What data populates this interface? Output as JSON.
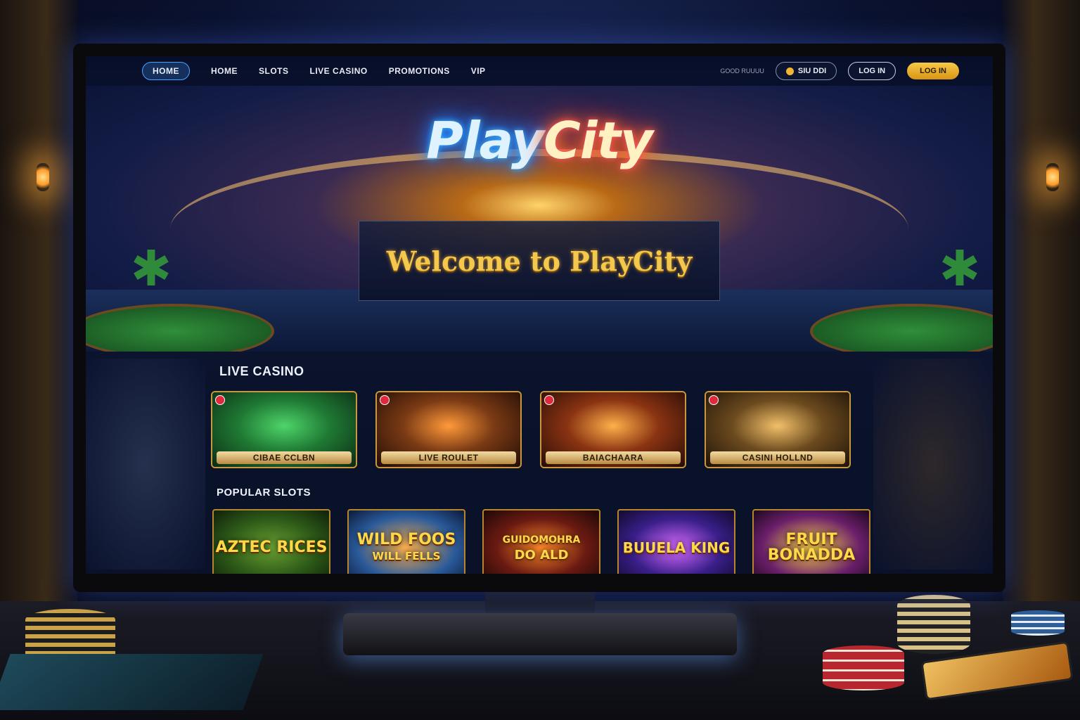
{
  "nav": {
    "items": [
      "HOME",
      "HOME",
      "SLOTS",
      "LIVE CASINO",
      "PROMOTIONS",
      "VIP"
    ],
    "language": "GOOD RUUUU",
    "balance": "SIU DDI",
    "login": "LOG IN",
    "join": "LOG IN"
  },
  "hero": {
    "brand_part1": "Play",
    "brand_part2": "City",
    "welcome": "Welcome to PlayCity"
  },
  "live_casino": {
    "title": "LIVE CASINO",
    "cards": [
      {
        "label": "CIBAE CCLBN",
        "color": "#1f7a34"
      },
      {
        "label": "LIVE ROULET",
        "color": "#7a3a14"
      },
      {
        "label": "BAIACHAARA",
        "color": "#8a3312"
      },
      {
        "label": "CASINI HOLLND",
        "color": "#6b4a1e"
      }
    ]
  },
  "popular_slots": {
    "title": "POPULAR SLOTS",
    "cards": [
      {
        "line1": "AZTEC RICES",
        "line2": "",
        "color": "#2d5a18"
      },
      {
        "line1": "WILD FOOS",
        "line2": "WILL FELLS",
        "color": "#2a5a9a"
      },
      {
        "line1": "GUIDOMOHRA",
        "line2": "DO ALD",
        "color": "#6a1a12"
      },
      {
        "line1": "BUUELA KING",
        "line2": "",
        "color": "#3a1f8a"
      },
      {
        "line1": "FRUIT",
        "line2": "BONADDA",
        "color": "#6a1f6a"
      }
    ]
  },
  "colors": {
    "accent_blue": "#38b6ff",
    "accent_gold": "#f4c84d",
    "join_button": "#f7c948"
  }
}
